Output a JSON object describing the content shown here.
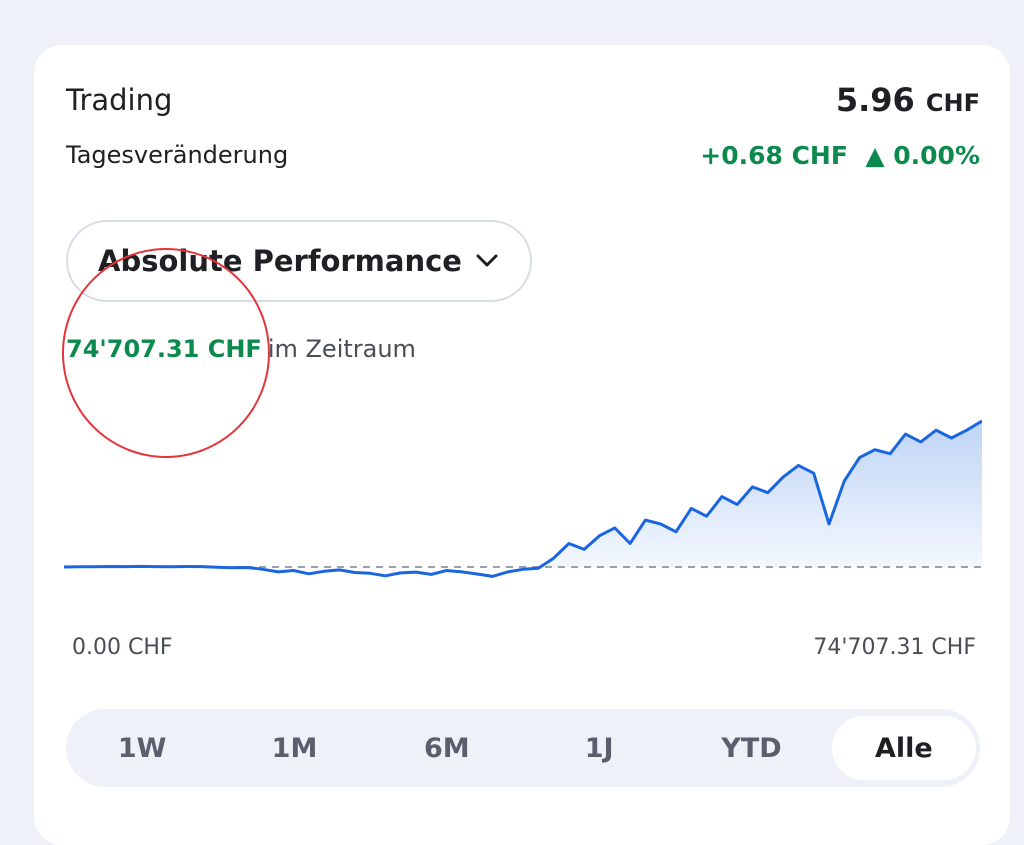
{
  "header": {
    "title": "Trading",
    "total_value": "5.96",
    "total_currency": "CHF",
    "subtitle": "Tagesveränderung",
    "change_text": "+0.68 CHF  ▲ 0.00%"
  },
  "dropdown": {
    "label": "Absolute Performance",
    "icon": "chevron-down-icon"
  },
  "performance": {
    "value": "74'707.31 CHF",
    "label": "im Zeitraum"
  },
  "axis": {
    "min_label": "0.00 CHF",
    "max_label": "74'707.31 CHF"
  },
  "tabs": [
    {
      "label": "1W",
      "active": false
    },
    {
      "label": "1M",
      "active": false
    },
    {
      "label": "6M",
      "active": false
    },
    {
      "label": "1J",
      "active": false
    },
    {
      "label": "YTD",
      "active": false
    },
    {
      "label": "Alle",
      "active": true
    }
  ],
  "colors": {
    "positive": "#0c8a4e",
    "line": "#1a66e0",
    "annotation": "#e3343a"
  },
  "chart_data": {
    "type": "area",
    "ylim": [
      -10,
      74707.31
    ],
    "values": [
      0,
      120,
      80,
      250,
      180,
      300,
      220,
      150,
      260,
      200,
      -100,
      -400,
      -250,
      -1200,
      -2500,
      -1800,
      -3500,
      -2200,
      -1500,
      -2800,
      -3200,
      -4500,
      -3000,
      -2600,
      -3800,
      -1800,
      -2500,
      -3600,
      -4800,
      -2500,
      -1200,
      -600,
      4500,
      12000,
      9000,
      16000,
      20000,
      12000,
      24000,
      22000,
      18000,
      30000,
      26000,
      36000,
      32000,
      41000,
      38000,
      46000,
      52000,
      48000,
      22000,
      44000,
      56000,
      60000,
      58000,
      68000,
      64000,
      70000,
      66000,
      70000,
      74707.31
    ]
  }
}
